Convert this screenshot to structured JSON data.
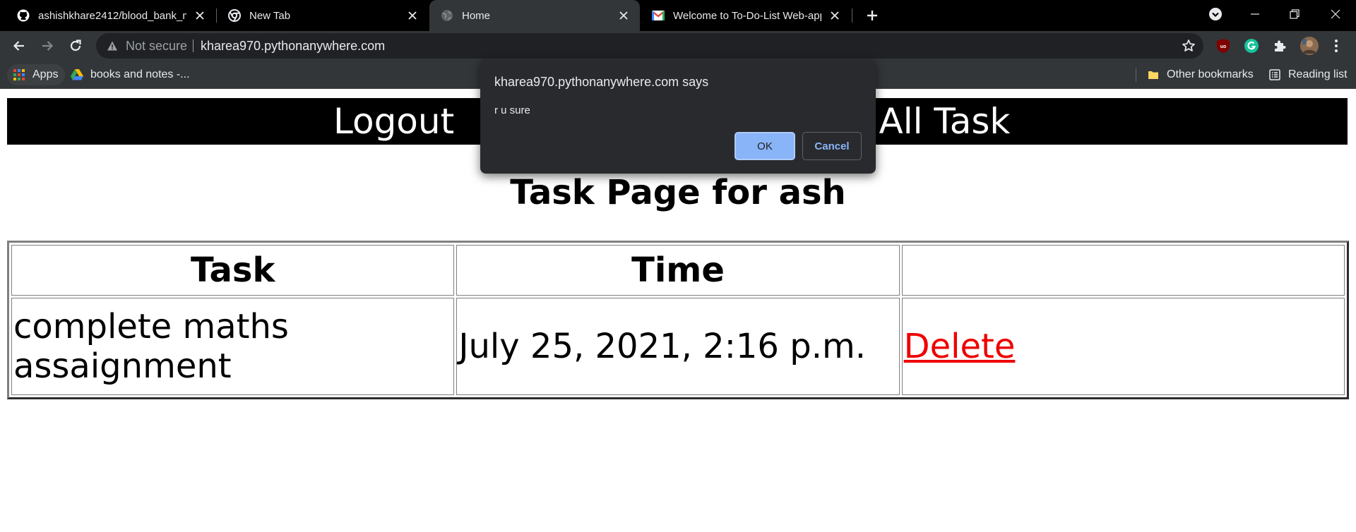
{
  "browser": {
    "tabs": [
      {
        "title": "ashishkhare2412/blood_bank_ma",
        "icon": "github-icon",
        "active": false
      },
      {
        "title": "New Tab",
        "icon": "chrome-icon",
        "active": false
      },
      {
        "title": "Home",
        "icon": "globe-icon",
        "active": true
      },
      {
        "title": "Welcome to To-Do-List Web-app",
        "icon": "gmail-icon",
        "active": false
      }
    ],
    "omnibox": {
      "security_label": "Not secure",
      "url": "kharea970.pythonanywhere.com"
    },
    "bookmarks": {
      "apps_label": "Apps",
      "items": [
        {
          "label": "books and notes -...",
          "icon": "google-drive-icon"
        }
      ],
      "other_label": "Other bookmarks",
      "reading_list_label": "Reading list"
    },
    "colors": {
      "accent": "#8ab4f8",
      "chrome_bg": "#323639",
      "tabstrip_bg": "#000000"
    }
  },
  "site": {
    "nav": {
      "logout": "Logout",
      "view_all": "View All Task"
    },
    "title": "Task Page for ash",
    "table": {
      "headers": [
        "Task",
        "Time",
        ""
      ],
      "rows": [
        {
          "task": "complete maths assaignment",
          "time": "July 25, 2021, 2:16 p.m.",
          "action": "Delete"
        }
      ]
    },
    "colors": {
      "delete_link": "#ee0000"
    }
  },
  "dialog": {
    "origin": "kharea970.pythonanywhere.com says",
    "message": "r u sure",
    "ok_label": "OK",
    "cancel_label": "Cancel"
  }
}
